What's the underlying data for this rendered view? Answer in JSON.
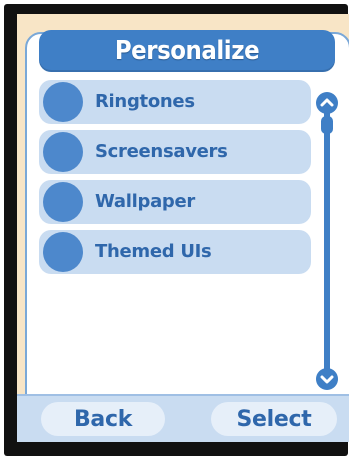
{
  "header": {
    "title": "Personalize"
  },
  "menu": {
    "items": [
      {
        "label": "Ringtones",
        "icon": "circle-icon"
      },
      {
        "label": "Screensavers",
        "icon": "circle-icon"
      },
      {
        "label": "Wallpaper",
        "icon": "circle-icon"
      },
      {
        "label": "Themed UIs",
        "icon": "circle-icon"
      }
    ]
  },
  "softkeys": {
    "left_label": "Back",
    "right_label": "Select"
  },
  "colors": {
    "accent": "#3f7fc6",
    "item_background": "#c9dcf1",
    "item_text": "#2f67ab",
    "screen_background": "#f8e5c6",
    "frame": "#111111"
  },
  "scrollbar": {
    "up_icon": "scroll-up-arrow-icon",
    "down_icon": "scroll-down-arrow-icon"
  }
}
